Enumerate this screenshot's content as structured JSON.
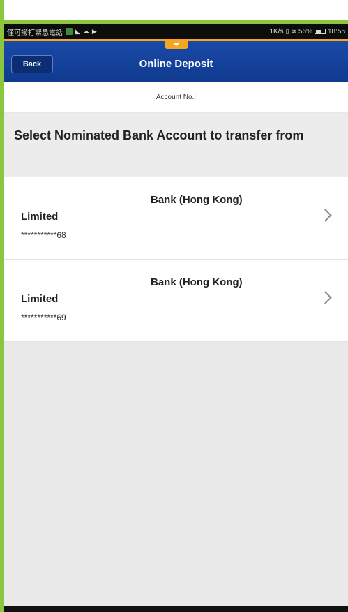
{
  "status_bar": {
    "carrier_text": "僅可撥打緊急電話",
    "right_text": "1K/s",
    "battery": "56%",
    "time": "18:55"
  },
  "navbar": {
    "back_label": "Back",
    "title": "Online Deposit"
  },
  "account": {
    "label": "Account No.:"
  },
  "section": {
    "title": "Select Nominated Bank Account to transfer from"
  },
  "bank_accounts": [
    {
      "line1": "Bank (Hong Kong)",
      "line2": "Limited",
      "account": "***********68"
    },
    {
      "line1": "Bank (Hong Kong)",
      "line2": "Limited",
      "account": "***********69"
    }
  ],
  "colors": {
    "nav_blue": "#1a4aa8",
    "accent_orange": "#f5a623",
    "frame_green": "#8cc63f"
  }
}
